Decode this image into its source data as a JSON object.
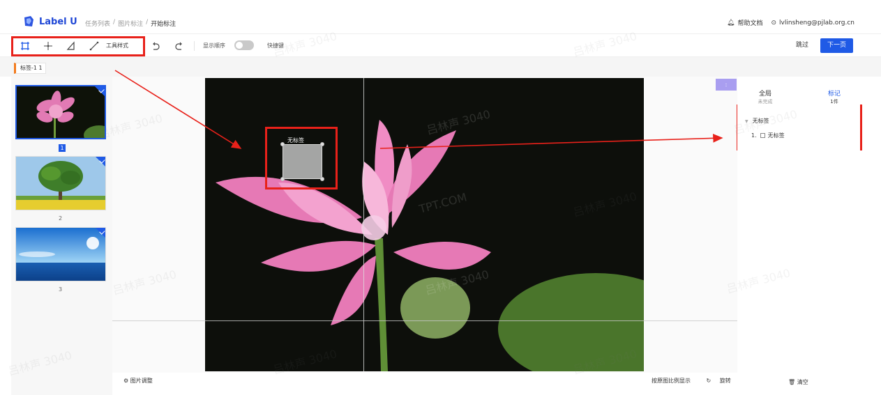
{
  "app": {
    "name": "Label U"
  },
  "breadcrumb": {
    "items": [
      "任务列表",
      "/",
      "图片标注",
      "/"
    ],
    "current": "开始标注"
  },
  "header_right": {
    "help": "帮助文档",
    "user": "lvlinsheng@pjlab.org.cn"
  },
  "toolbar": {
    "tools": [
      "rect-tool",
      "point-tool",
      "polygon-tool",
      "line-tool"
    ],
    "tool_style_label": "工具样式",
    "show_order_label": "显示顺序",
    "show_order_on": false,
    "shortcuts_label": "快捷键",
    "skip_label": "跳过",
    "next_label": "下一页"
  },
  "label_bar": {
    "tag": "标签-1 1"
  },
  "thumbnails": [
    {
      "number": "1",
      "selected": true,
      "done": true
    },
    {
      "number": "2",
      "selected": false,
      "done": true
    },
    {
      "number": "3",
      "selected": false,
      "done": true
    }
  ],
  "canvas": {
    "bbox_label": "无标签",
    "adjust_label": "图片调整",
    "original_ratio_label": "按原图比例显示",
    "rotate_label": "旋转"
  },
  "right_panel": {
    "toggle_label": ":",
    "tabs": [
      {
        "label": "全局",
        "sub": "未完成",
        "active": false
      },
      {
        "label": "标记",
        "sub": "1件",
        "active": true
      }
    ],
    "tree": {
      "group": "无标签",
      "items": [
        {
          "index": "1.",
          "label": "无标签"
        }
      ]
    },
    "clear_label": "清空"
  },
  "watermark": {
    "text": "吕林声 3040",
    "text2": "TPT.COM"
  },
  "colors": {
    "accent": "#1f5ae6",
    "annotation_red": "#e8211a",
    "tag_orange": "#f37b1d"
  }
}
